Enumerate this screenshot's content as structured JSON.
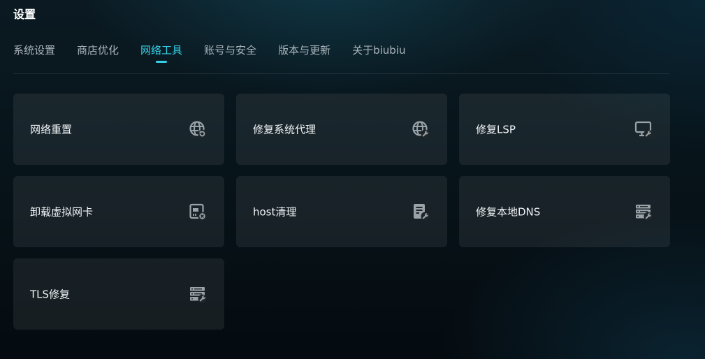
{
  "page": {
    "title": "设置"
  },
  "tabs": [
    {
      "label": "系统设置",
      "active": false
    },
    {
      "label": "商店优化",
      "active": false
    },
    {
      "label": "网络工具",
      "active": true
    },
    {
      "label": "账号与安全",
      "active": false
    },
    {
      "label": "版本与更新",
      "active": false
    },
    {
      "label": "关于biubiu",
      "active": false
    }
  ],
  "colors": {
    "accent": "#35d0e6",
    "tab_inactive": "#aab4ba",
    "icon": "#9aa3a8"
  },
  "tools": [
    {
      "label": "网络重置",
      "icon": "globe-refresh-icon"
    },
    {
      "label": "修复系统代理",
      "icon": "globe-wrench-icon"
    },
    {
      "label": "修复LSP",
      "icon": "monitor-wrench-icon"
    },
    {
      "label": "卸载虚拟网卡",
      "icon": "network-card-remove-icon"
    },
    {
      "label": "host清理",
      "icon": "document-wrench-icon"
    },
    {
      "label": "修复本地DNS",
      "icon": "server-wrench-icon"
    },
    {
      "label": "TLS修复",
      "icon": "server-wrench-icon"
    }
  ]
}
